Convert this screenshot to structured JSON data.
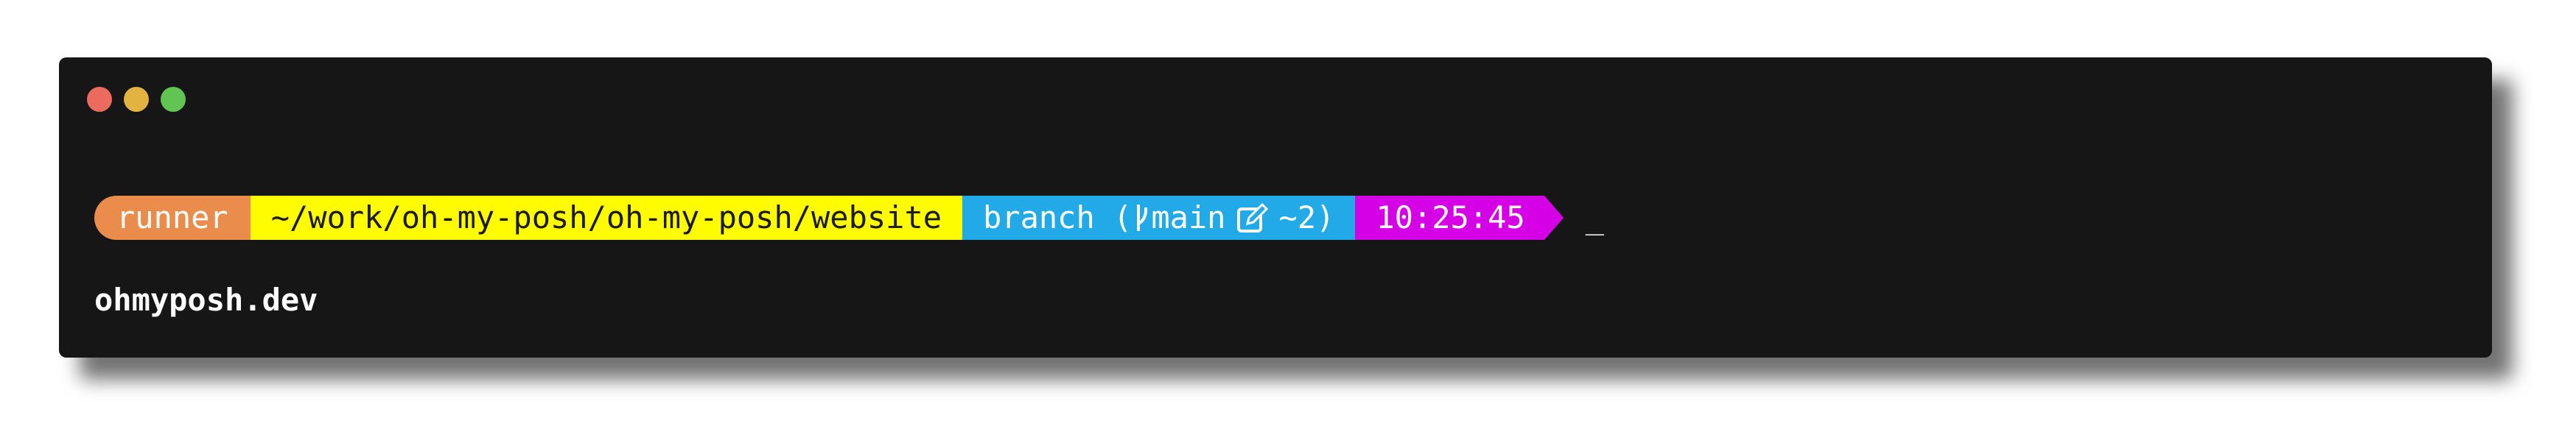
{
  "window": {
    "controls": [
      {
        "name": "close",
        "color": "#ed6a5e"
      },
      {
        "name": "minimize",
        "color": "#e3b341"
      },
      {
        "name": "maximize",
        "color": "#61c554"
      }
    ],
    "background": "#161616"
  },
  "prompt": {
    "user": {
      "text": "runner",
      "color": "#ea8d4c"
    },
    "path": {
      "text": "~/work/oh-my-posh/oh-my-posh/website",
      "color": "#fffb00"
    },
    "git": {
      "prefix": "branch (",
      "branch_icon": "git-branch-icon",
      "branch": "main",
      "edit_icon": "edit-icon",
      "changes": "~2)",
      "color": "#22aae8"
    },
    "time": {
      "text": "10:25:45",
      "color": "#d600e6"
    },
    "cursor": "_"
  },
  "footer": {
    "url": "ohmyposh.dev"
  }
}
